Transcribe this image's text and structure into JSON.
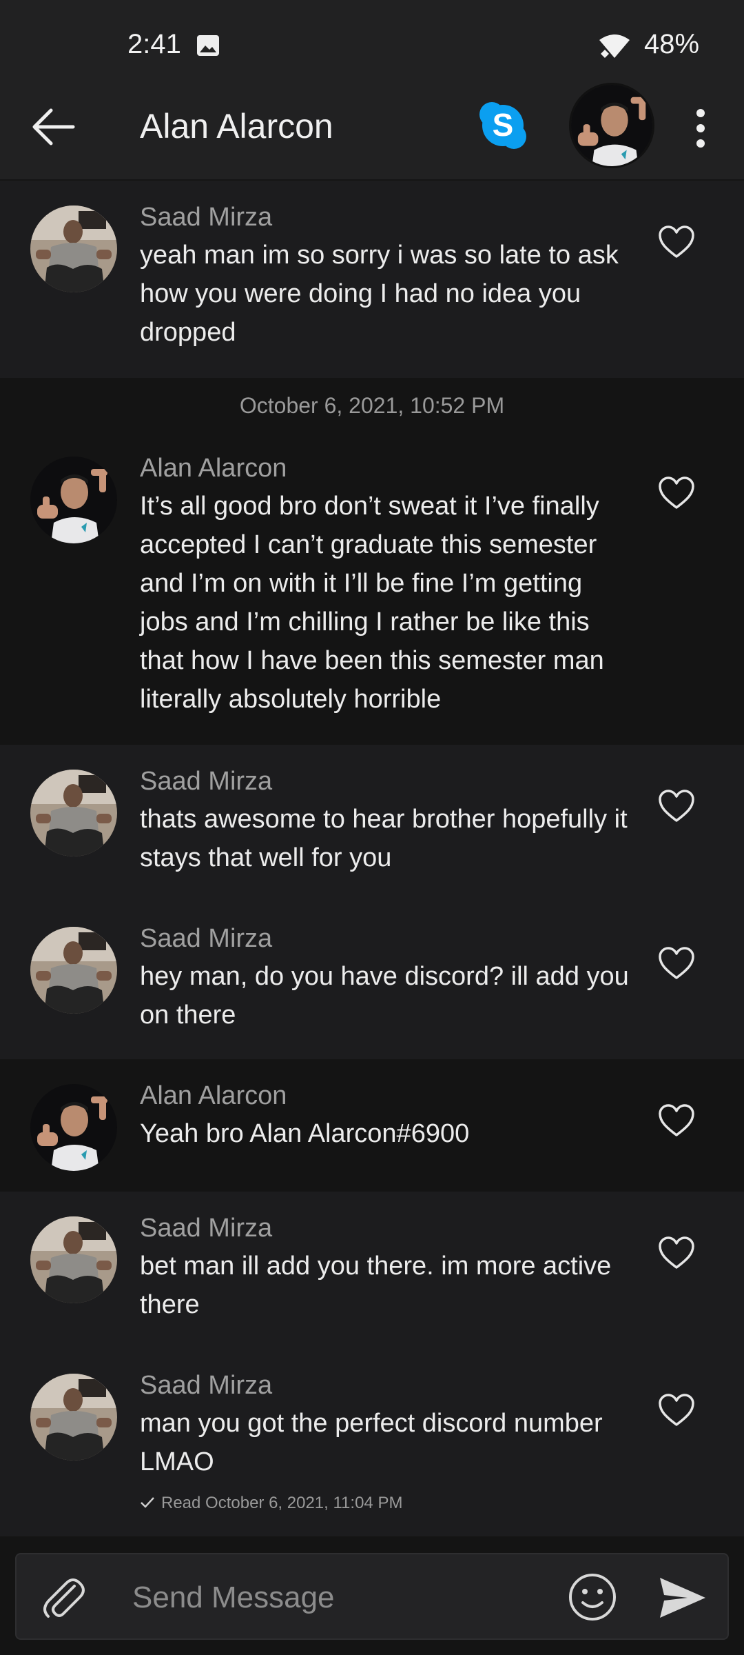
{
  "status_bar": {
    "time": "2:41",
    "battery": "48%",
    "icons": [
      "image-icon",
      "wifi-icon"
    ]
  },
  "header": {
    "title": "Alan Alarcon",
    "icons": [
      "back-arrow-icon",
      "skype-icon",
      "more-vert-icon"
    ]
  },
  "messages": [
    {
      "sender": "Saad Mirza",
      "text": "yeah man im so sorry i was so late to ask how you were doing I had no idea you dropped"
    },
    {
      "sender": "Alan Alarcon",
      "text": "It’s all good bro don’t sweat it I’ve finally accepted I can’t graduate this semester and I’m on with it I’ll be fine I’m getting jobs and I’m chilling I rather be like this that how I have been this semester man literally absolutely horrible"
    },
    {
      "sender": "Saad Mirza",
      "text": "thats awesome to hear brother hopefully it stays that well for you"
    },
    {
      "sender": "Saad Mirza",
      "text": "hey man, do you have discord? ill add you on there"
    },
    {
      "sender": "Alan Alarcon",
      "text": "Yeah bro Alan Alarcon#6900"
    },
    {
      "sender": "Saad Mirza",
      "text": "bet man ill add you there. im more active there"
    },
    {
      "sender": "Saad Mirza",
      "text": "man you got the perfect discord number LMAO"
    }
  ],
  "timestamp": "October 6, 2021, 10:52 PM",
  "read_receipt": "Read October 6, 2021, 11:04 PM",
  "composer": {
    "placeholder": "Send Message",
    "icons": [
      "paperclip-icon",
      "emoji-icon",
      "send-icon"
    ]
  },
  "colors": {
    "background": "#1c1c1e",
    "alt_background": "#141414",
    "skype_blue": "#0b9ff0",
    "text": "#ececec",
    "muted": "#9a9a9a"
  }
}
